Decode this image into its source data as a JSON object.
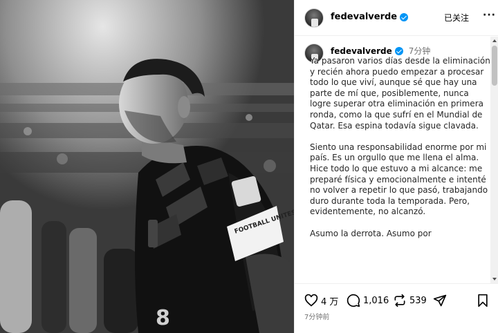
{
  "photo": {
    "jersey_number": "8",
    "armband_text": "FOOTBALL UNITES"
  },
  "header": {
    "username": "fedevalverde",
    "follow_label": "已关注",
    "more_label": "···"
  },
  "caption": {
    "username": "fedevalverde",
    "time": "7分钟",
    "text": "Ya pasaron varios días desde la eliminación y recién ahora puedo empezar a procesar todo lo que viví, aunque sé que hay una parte de mí que, posiblemente, nunca logre superar otra eliminación en primera ronda, como la que sufrí en el Mundial de Qatar. Esa espina todavía sigue clavada.\n\nSiento una responsabilidad enorme por mi país. Es un orgullo que me llena el alma. Hice todo lo que estuvo a mi alcance: me preparé física y emocionalmente e intenté no volver a repetir lo que pasó, trabajando duro durante toda la temporada. Pero, evidentemente, no alcanzó.\n\nAsumo la derrota. Asumo por"
  },
  "actions": {
    "likes": "4 万",
    "comments": "1,016",
    "shares": "539"
  },
  "timestamp": "7分钟前",
  "icons": {
    "verified": "verified-badge-icon",
    "like": "heart-icon",
    "comment": "comment-bubble-icon",
    "repost": "repost-icon",
    "send": "paper-plane-icon",
    "save": "bookmark-icon"
  },
  "colors": {
    "verified_blue": "#0095f6",
    "secondary_text": "#737373",
    "divider": "#efefef"
  }
}
